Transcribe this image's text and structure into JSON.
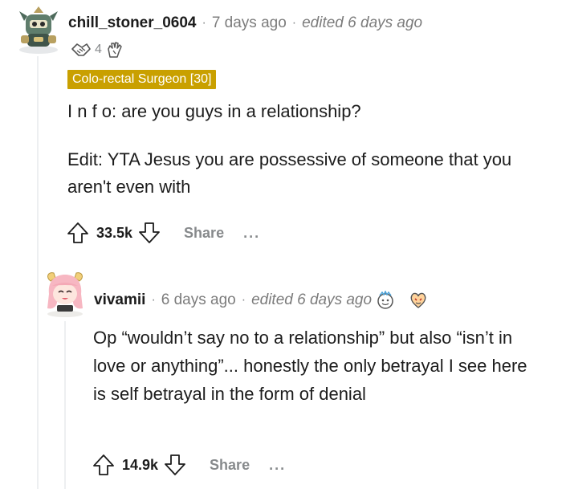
{
  "comment": {
    "username": "chill_stoner_0604",
    "time": "7 days ago",
    "edited": "edited 6 days ago",
    "award_count": "4",
    "flair": "Colo-rectal Surgeon [30]",
    "body_line1": "I n f o: are you guys in a relationship?",
    "body_line2": "Edit: YTA Jesus you are possessive of someone that you aren't even with",
    "votes": "33.5k",
    "share_label": "Share",
    "more_label": "..."
  },
  "reply": {
    "username": "vivamii",
    "time": "6 days ago",
    "edited": "edited 6 days ago",
    "body": "Op “wouldn’t say no to a relationship” but also “isn’t in love or anything”... honestly the only betrayal I see here is self betrayal in the form of denial",
    "votes": "14.9k",
    "share_label": "Share",
    "more_label": "..."
  },
  "colors": {
    "flair_bg": "#c9a000",
    "muted_text": "#878a8c",
    "thread_line": "#edeff1"
  }
}
